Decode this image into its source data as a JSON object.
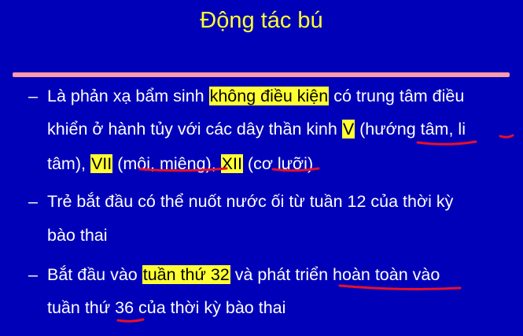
{
  "slide": {
    "title": "Động tác bú",
    "bullet_marker": "–",
    "bullets": [
      {
        "lines": [
          {
            "t1": "Là phản xạ bẩm sinh ",
            "h1": "không điều kiện",
            "t2": " có trung tâm điều"
          },
          {
            "t1": "khiển ở hành tủy với các dây thần kinh ",
            "h1": "V",
            "t2": " (hướng tâm, li"
          },
          {
            "t1": "tâm), ",
            "h1": "VII",
            "t2": " (môi, miệng), ",
            "h2": "XII",
            "t3": " (cơ lưỡi)"
          }
        ]
      },
      {
        "lines": [
          {
            "t1": "Trẻ bắt đầu có thể nuốt nước ối từ tuần 12 của thời kỳ"
          },
          {
            "t1": "bào thai"
          }
        ]
      },
      {
        "lines": [
          {
            "t1": "Bắt đầu vào ",
            "h1": "tuần thứ 32",
            "t2": " và phát triển hoàn toàn vào"
          },
          {
            "t1": "tuần thứ 36 của thời kỳ bào thai"
          }
        ]
      }
    ],
    "colors": {
      "background": "#0000b8",
      "title": "#ffff33",
      "text": "#ffffff",
      "highlight": "#ffff33",
      "rule": "#ff9aa8",
      "annotation": "#e8102a"
    }
  }
}
